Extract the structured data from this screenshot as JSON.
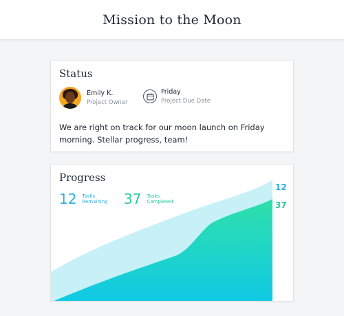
{
  "header": {
    "title": "Mission to the Moon"
  },
  "status": {
    "title": "Status",
    "owner": {
      "name": "Emily K.",
      "role": "Project Owner"
    },
    "due": {
      "day": "Friday",
      "label": "Project Due Date"
    },
    "message": "We are right on track for our moon launch on Friday morning. Stellar progress, team!"
  },
  "progress": {
    "title": "Progress",
    "remaining": {
      "count": "12",
      "label_line1": "Tasks",
      "label_line2": "Remaining"
    },
    "completed": {
      "count": "37",
      "label_line1": "Tasks",
      "label_line2": "Completed"
    }
  },
  "colors": {
    "remaining_area": "#c8f1f7",
    "completed_top": "#2fe0a8",
    "completed_bottom": "#10c9e6",
    "remaining_text": "#2bb0e0",
    "completed_text": "#27c99a"
  },
  "chart_data": {
    "type": "area",
    "series": [
      {
        "name": "Tasks Remaining",
        "end_label": "12"
      },
      {
        "name": "Tasks Completed",
        "end_label": "37"
      }
    ]
  }
}
